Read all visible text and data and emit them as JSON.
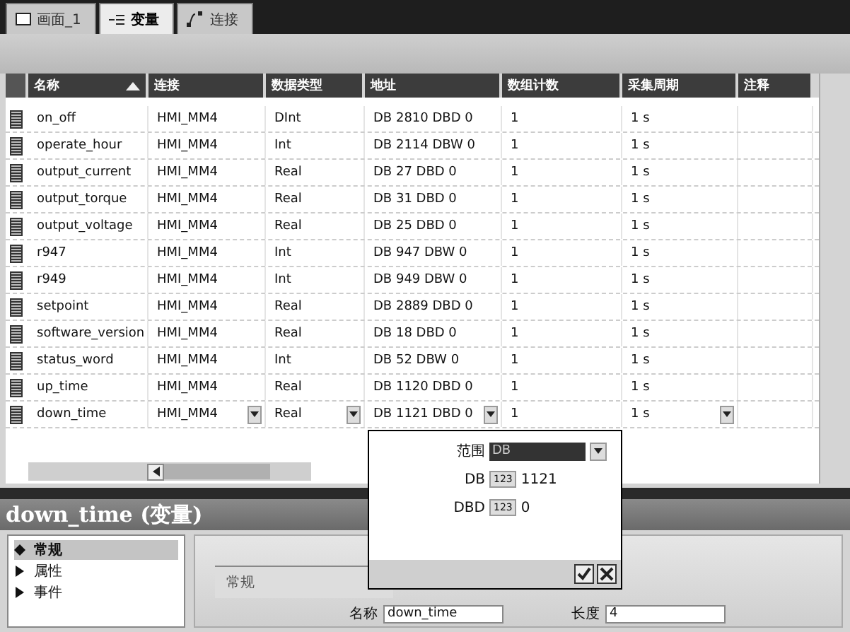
{
  "tabs": [
    {
      "label": "画面_1",
      "kind": "screen",
      "selected": false
    },
    {
      "label": "变量",
      "kind": "tags",
      "selected": true
    },
    {
      "label": "连接",
      "kind": "connection",
      "selected": false
    }
  ],
  "table": {
    "columns": [
      {
        "label": "名称",
        "sorted": true
      },
      {
        "label": "连接",
        "sorted": false
      },
      {
        "label": "数据类型",
        "sorted": false
      },
      {
        "label": "地址",
        "sorted": false
      },
      {
        "label": "数组计数",
        "sorted": false
      },
      {
        "label": "采集周期",
        "sorted": false
      },
      {
        "label": "注释",
        "sorted": false
      }
    ],
    "rows": [
      {
        "name": "on_off",
        "connection": "HMI_MM4",
        "data_type": "DInt",
        "address": "DB 2810 DBD 0",
        "array_count": "1",
        "cycle": "1 s",
        "editing": false
      },
      {
        "name": "operate_hour",
        "connection": "HMI_MM4",
        "data_type": "Int",
        "address": "DB 2114 DBW 0",
        "array_count": "1",
        "cycle": "1 s",
        "editing": false
      },
      {
        "name": "output_current",
        "connection": "HMI_MM4",
        "data_type": "Real",
        "address": "DB 27 DBD 0",
        "array_count": "1",
        "cycle": "1 s",
        "editing": false
      },
      {
        "name": "output_torque",
        "connection": "HMI_MM4",
        "data_type": "Real",
        "address": "DB 31 DBD 0",
        "array_count": "1",
        "cycle": "1 s",
        "editing": false
      },
      {
        "name": "output_voltage",
        "connection": "HMI_MM4",
        "data_type": "Real",
        "address": "DB 25 DBD 0",
        "array_count": "1",
        "cycle": "1 s",
        "editing": false
      },
      {
        "name": "r947",
        "connection": "HMI_MM4",
        "data_type": "Int",
        "address": "DB 947 DBW 0",
        "array_count": "1",
        "cycle": "1 s",
        "editing": false
      },
      {
        "name": "r949",
        "connection": "HMI_MM4",
        "data_type": "Int",
        "address": "DB 949 DBW 0",
        "array_count": "1",
        "cycle": "1 s",
        "editing": false
      },
      {
        "name": "setpoint",
        "connection": "HMI_MM4",
        "data_type": "Real",
        "address": "DB 2889 DBD 0",
        "array_count": "1",
        "cycle": "1 s",
        "editing": false
      },
      {
        "name": "software_version",
        "connection": "HMI_MM4",
        "data_type": "Real",
        "address": "DB 18 DBD 0",
        "array_count": "1",
        "cycle": "1 s",
        "editing": false
      },
      {
        "name": "status_word",
        "connection": "HMI_MM4",
        "data_type": "Int",
        "address": "DB 52 DBW 0",
        "array_count": "1",
        "cycle": "1 s",
        "editing": false
      },
      {
        "name": "up_time",
        "connection": "HMI_MM4",
        "data_type": "Real",
        "address": "DB 1120 DBD 0",
        "array_count": "1",
        "cycle": "1 s",
        "editing": false
      },
      {
        "name": "down_time",
        "connection": "HMI_MM4",
        "data_type": "Real",
        "address": "DB 1121 DBD 0",
        "array_count": "1",
        "cycle": "1 s",
        "editing": true
      }
    ]
  },
  "address_popup": {
    "range_label": "范围",
    "range_value": "DB",
    "fields": [
      {
        "label": "DB",
        "icon_text": "123",
        "value": "1121"
      },
      {
        "label": "DBD",
        "icon_text": "123",
        "value": "0"
      }
    ]
  },
  "details": {
    "title": "down_time (变量)",
    "nav": [
      {
        "label": "常规",
        "selected": true
      },
      {
        "label": "属性",
        "selected": false
      },
      {
        "label": "事件",
        "selected": false
      }
    ],
    "section": "常规",
    "name_label": "名称",
    "name_value": "down_time",
    "length_label": "长度",
    "length_value": "4"
  }
}
